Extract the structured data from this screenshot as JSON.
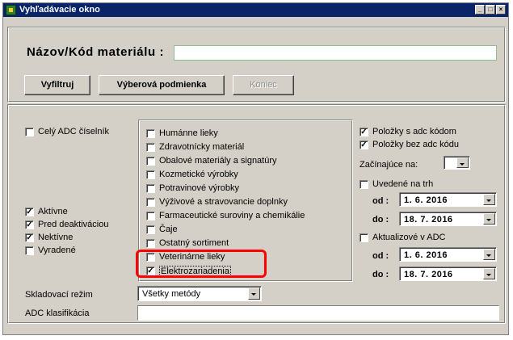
{
  "window": {
    "title": "Vyhľadávacie okno",
    "titlebar_buttons": [
      "_",
      "□",
      "×"
    ]
  },
  "search": {
    "label": "Názov/Kód materiálu :",
    "value": ""
  },
  "buttons": {
    "filter": "Vyfiltruj",
    "condition": "Výberová podmienka",
    "end": "Koniec"
  },
  "left": {
    "all_adc": {
      "label": "Celý ADC číselník",
      "checked": false
    },
    "status": [
      {
        "label": "Aktívne",
        "checked": true
      },
      {
        "label": "Pred deaktiváciou",
        "checked": true
      },
      {
        "label": "Nektívne",
        "checked": true
      },
      {
        "label": "Vyradené",
        "checked": false
      }
    ]
  },
  "categories": [
    {
      "label": "Humánne lieky",
      "checked": false
    },
    {
      "label": "Zdravotnícky materiál",
      "checked": false
    },
    {
      "label": "Obalové materiály a signatúry",
      "checked": false
    },
    {
      "label": "Kozmetické výrobky",
      "checked": false
    },
    {
      "label": "Potravinové výrobky",
      "checked": false
    },
    {
      "label": "Výživové a stravovancie doplnky",
      "checked": false
    },
    {
      "label": "Farmaceutické suroviny a chemikálie",
      "checked": false
    },
    {
      "label": "Čaje",
      "checked": false
    },
    {
      "label": "Ostatný sortiment",
      "checked": false
    },
    {
      "label": "Veterinárne lieky",
      "checked": false
    },
    {
      "label": "Elektrozariadenia",
      "checked": true
    }
  ],
  "right": {
    "with_adc": {
      "label": "Položky s adc kódom",
      "checked": true
    },
    "without_adc": {
      "label": "Položky bez adc kódu",
      "checked": true
    },
    "starting_label": "Začínajúce na:",
    "starting_value": "",
    "market": {
      "label": "Uvedené na trh",
      "checked": false
    },
    "market_from_label": "od :",
    "market_from": "1. 6. 2016",
    "market_to_label": "do :",
    "market_to": "18. 7. 2016",
    "updated": {
      "label": "Aktualizové v ADC",
      "checked": false
    },
    "updated_from_label": "od :",
    "updated_from": "1. 6. 2016",
    "updated_to_label": "do :",
    "updated_to": "18. 7. 2016"
  },
  "bottom": {
    "storage_label": "Skladovací režim",
    "storage_value": "Všetky metódy",
    "adc_class_label": "ADC klasifikácia",
    "adc_class_value": ""
  },
  "colors": {
    "titlebar": "#0a246a",
    "face": "#d4d0c8",
    "highlight": "#ff0000"
  }
}
